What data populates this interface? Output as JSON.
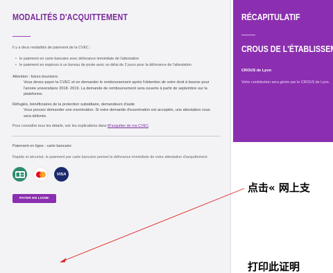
{
  "left": {
    "title": "MODALITÉS D'ACQUITTEMENT",
    "intro": "Il y a deux modalités de paiement de la CVEC :",
    "bullets": [
      "le paiement en carte bancaire avec délivrance immédiate de l'attestation",
      "le paiement en espèces à un bureau de poste avec un délai de 2 jours pour la délivrance de l'attestation"
    ],
    "boursiers_title": "Attention : futurs boursiers",
    "boursiers_text": "Vous devez payer la CVEC et en demander le remboursement après l'obtention de votre droit à bourse pour l'année universitaire 2018- 2019. La demande de remboursement sera ouverte à partir de septembre sur la plateforme.",
    "refugies_title": "Réfugiés, bénéficiaires de la protection subsidiaire, demandeurs d'asile",
    "refugies_text": "Vous pouvez demander une exonération. Si votre demande d'exonération est acceptée, une attestation vous sera délivrée.",
    "details_prefix": "Pour connaître tous les détails, voir les explications dans ",
    "details_link": "M'acquitter de ma CVEC",
    "details_suffix": ".",
    "pay_title": "Paiement en ligne : carte bancaire",
    "pay_desc": "Rapide et sécurisé, le paiement par carte bancaire permet la délivrance immédiate de votre attestation d'acquittement.",
    "cards": [
      {
        "name": "cb",
        "icon": "cb-card-icon"
      },
      {
        "name": "mastercard",
        "icon": "mastercard-icon"
      },
      {
        "name": "visa",
        "icon": "visa-icon",
        "label": "VISA"
      }
    ],
    "pay_button": "PAYER EN LIGNE"
  },
  "right": {
    "title": "RÉCAPITULATIF",
    "subtitle": "CROUS DE L'ÉTABLISSEMENT",
    "crous_name": "CROUS de Lyon",
    "contribution_text": "Votre contribution sera gérée par le CROUS de Lyon."
  },
  "annotations": {
    "click_text": "点击« 网上支",
    "print_text": "打印此证明"
  },
  "colors": {
    "accent": "#8b2fb0",
    "title": "#7a2a9a",
    "arrow": "#e0201e"
  }
}
